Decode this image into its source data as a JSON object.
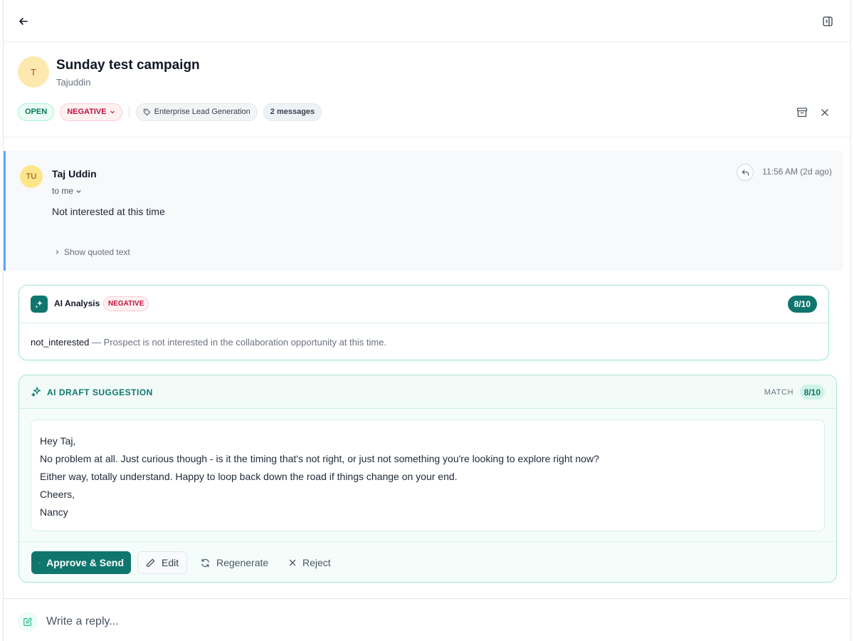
{
  "header": {
    "avatar_initial": "T",
    "title": "Sunday test campaign",
    "subtitle": "Tajuddin",
    "status": "OPEN",
    "sentiment": "NEGATIVE",
    "tag": "Enterprise Lead Generation",
    "message_count": "2 messages"
  },
  "message": {
    "avatar_initials": "TU",
    "sender": "Taj Uddin",
    "to": "to me",
    "timestamp": "11:56 AM (2d ago)",
    "body": "Not interested at this time",
    "show_quoted": "Show quoted text"
  },
  "analysis": {
    "label": "AI Analysis",
    "sentiment": "NEGATIVE",
    "score": "8/10",
    "category": "not_interested",
    "description": " — Prospect is not interested in the collaboration opportunity at this time."
  },
  "draft": {
    "label": "AI DRAFT SUGGESTION",
    "match_label": "MATCH",
    "match_score": "8/10",
    "lines": [
      "Hey Taj,",
      "No problem at all. Just curious though - is it the timing that's not right, or just not something you're looking to explore right now?",
      "Either way, totally understand. Happy to loop back down the road if things change on your end.",
      "Cheers,",
      "Nancy"
    ],
    "approve_label": "Approve & Send",
    "edit_label": "Edit",
    "regenerate_label": "Regenerate",
    "reject_label": "Reject"
  },
  "reply": {
    "placeholder": "Write a reply..."
  },
  "colors": {
    "accent": "#0f766e",
    "negative": "#be123c",
    "open": "#047857",
    "message_border": "#60a5fa"
  },
  "icons": {
    "back": "arrow-left-icon",
    "panel": "panel-toggle-icon",
    "archive": "archive-icon",
    "close": "close-icon",
    "reply": "reply-icon",
    "sparkle": "sparkles-icon",
    "tag": "tag-icon",
    "compose": "pencil-square-icon"
  }
}
